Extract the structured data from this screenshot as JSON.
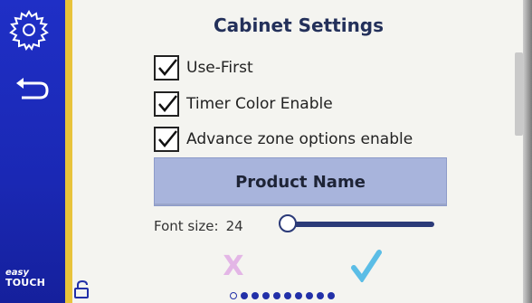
{
  "screen": {
    "title": "Cabinet Settings"
  },
  "sidebar": {
    "settings_icon": "gear-icon",
    "back_icon": "back-arrow-icon",
    "brand_line1": "easy",
    "brand_line2": "TOUCH"
  },
  "options": [
    {
      "label": "Use-First",
      "checked": true
    },
    {
      "label": "Timer Color Enable",
      "checked": true
    },
    {
      "label": "Advance zone options enable",
      "checked": true
    }
  ],
  "product_button": {
    "label": "Product Name"
  },
  "font_size": {
    "label": "Font size:",
    "value": "24"
  },
  "actions": {
    "cancel_icon": "x-icon",
    "confirm_icon": "check-icon",
    "cancel_glyph": "X",
    "lock_icon": "unlock-icon"
  },
  "pagination": {
    "total": 10,
    "current": 1
  },
  "colors": {
    "sidebar": "#1f2fc6",
    "accent_yellow": "#e8c33a",
    "button": "#a8b4dc",
    "cancel": "#e3b6e6",
    "confirm": "#5bbde6"
  }
}
